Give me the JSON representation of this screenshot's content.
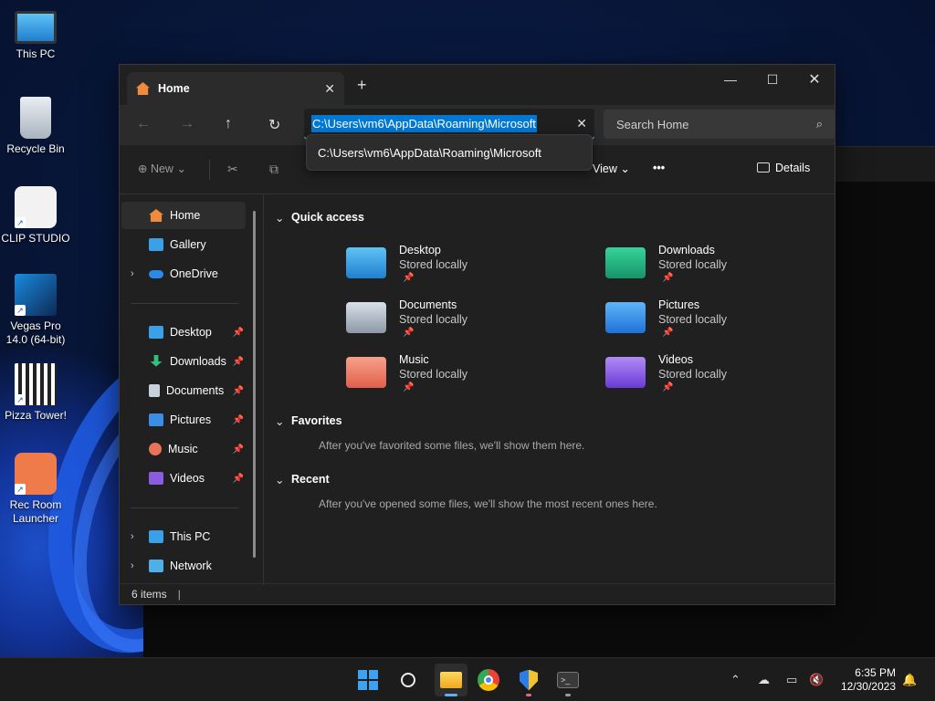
{
  "desktop": {
    "icons": [
      {
        "label": "This PC"
      },
      {
        "label": "Recycle Bin"
      },
      {
        "label": "CLIP STUDIO"
      },
      {
        "label": "Vegas Pro 14.0 (64-bit)"
      },
      {
        "label": "Pizza Tower!"
      },
      {
        "label": "Rec Room Launcher"
      }
    ]
  },
  "explorer": {
    "tab": {
      "title": "Home",
      "close": "✕"
    },
    "new_tab": "+",
    "window_controls": {
      "minimize": "—",
      "maximize": "☐",
      "close": "✕"
    },
    "nav": {
      "back": "←",
      "forward": "→",
      "up": "↑",
      "refresh": "↻"
    },
    "address": {
      "value": "C:\\Users\\vm6\\AppData\\Roaming\\Microsoft",
      "clear": "✕"
    },
    "search": {
      "placeholder": "Search Home",
      "icon": "⌕"
    },
    "suggestion": "C:\\Users\\vm6\\AppData\\Roaming\\Microsoft",
    "toolbar": {
      "new": "New",
      "new_chev": "⌄",
      "cut": "✂",
      "copy": "⧉",
      "view": "View",
      "view_chev": "⌄",
      "more": "•••",
      "details": "Details"
    },
    "sidebar": {
      "home": "Home",
      "gallery": "Gallery",
      "onedrive": "OneDrive",
      "pinned": [
        {
          "label": "Desktop",
          "color": "#3aa0e8"
        },
        {
          "label": "Downloads",
          "color": "#2ec27e"
        },
        {
          "label": "Documents",
          "color": "#c8d0da"
        },
        {
          "label": "Pictures",
          "color": "#3a8ee6"
        },
        {
          "label": "Music",
          "color": "#e8735a"
        },
        {
          "label": "Videos",
          "color": "#8a5ce0"
        }
      ],
      "this_pc": "This PC",
      "network": "Network",
      "pin_glyph": "📌",
      "chevron": "›"
    },
    "quick_access": {
      "title": "Quick access",
      "items": [
        {
          "name": "Desktop",
          "status": "Stored locally",
          "color": "#3aa0e8"
        },
        {
          "name": "Downloads",
          "status": "Stored locally",
          "color": "#22b07a"
        },
        {
          "name": "Documents",
          "status": "Stored locally",
          "color": "#b8c2ce"
        },
        {
          "name": "Pictures",
          "status": "Stored locally",
          "color": "#2f8fe8"
        },
        {
          "name": "Music",
          "status": "Stored locally",
          "color": "#ef7a62"
        },
        {
          "name": "Videos",
          "status": "Stored locally",
          "color": "#8b55e6"
        }
      ]
    },
    "favorites": {
      "title": "Favorites",
      "message": "After you've favorited some files, we'll show them here."
    },
    "recent": {
      "title": "Recent",
      "message": "After you've opened some files, we'll show the most recent ones here."
    },
    "section_chevron": "⌄",
    "status": {
      "count": "6 items",
      "sep": "|"
    }
  },
  "taskbar": {
    "time": "6:35 PM",
    "date": "12/30/2023",
    "tray_up": "⌃",
    "bell": "🔔"
  }
}
